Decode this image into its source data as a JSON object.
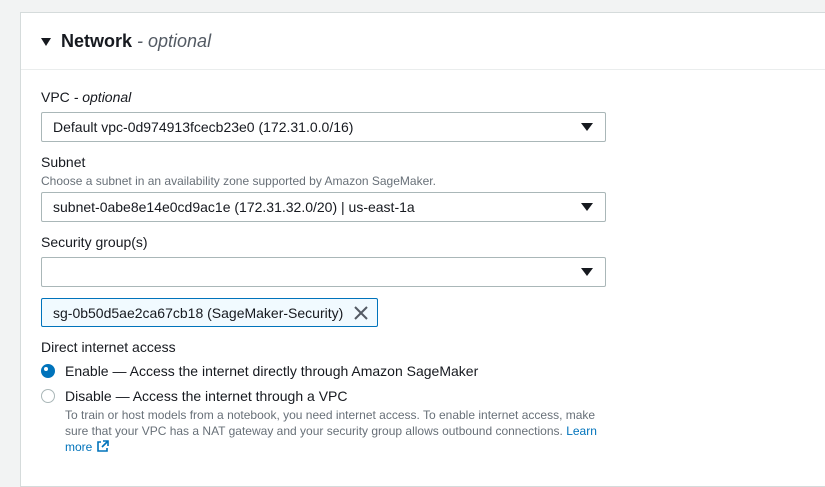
{
  "network": {
    "title": "Network",
    "title_optional": "- optional"
  },
  "vpc": {
    "label": "VPC",
    "label_optional": "- optional",
    "value": "Default vpc-0d974913fcecb23e0 (172.31.0.0/16)"
  },
  "subnet": {
    "label": "Subnet",
    "description": "Choose a subnet in an availability zone supported by Amazon SageMaker.",
    "value": "subnet-0abe8e14e0cd9ac1e (172.31.32.0/20) | us-east-1a"
  },
  "security_groups": {
    "label": "Security group(s)",
    "value": "",
    "tokens": [
      "sg-0b50d5ae2ca67cb18 (SageMaker-Security)"
    ]
  },
  "internet_access": {
    "label": "Direct internet access",
    "options": [
      {
        "label": "Enable — Access the internet directly through Amazon SageMaker",
        "selected": true
      },
      {
        "label": "Disable — Access the internet through a VPC",
        "selected": false
      }
    ],
    "disable_description": "To train or host models from a notebook, you need internet access. To enable internet access, make sure that your VPC has a NAT gateway and your security group allows outbound connections.",
    "learn_more": "Learn more"
  },
  "colors": {
    "accent": "#0073bb",
    "border": "#aab7b8",
    "text": "#16191f",
    "muted": "#687078"
  },
  "icons": [
    "caret-down-icon",
    "dropdown-arrow-icon",
    "close-icon",
    "external-link-icon"
  ]
}
